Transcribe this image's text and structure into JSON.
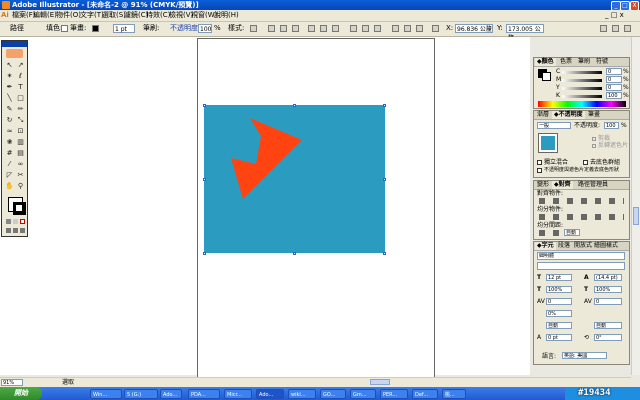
{
  "window": {
    "title": "Adobe Illustrator - [未命名-2 @ 91% (CMYK/預覽)]",
    "controls": [
      "_",
      "□",
      "X"
    ]
  },
  "menu": {
    "items": [
      "檔案(F)",
      "編輯(E)",
      "物件(O)",
      "文字(T)",
      "選取(S)",
      "濾鏡(C)",
      "特效(C)",
      "檢視(V)",
      "視窗(W)",
      "說明(H)"
    ]
  },
  "control_bar": {
    "object_label": "路徑",
    "fill_label": "填色:",
    "stroke_label": "筆畫:",
    "stroke_weight": "1 pt",
    "style_label": "樣式:",
    "opacity_label": "不透明度:",
    "opacity_value": "100",
    "percent": "%",
    "x_value": "96.836 公釐",
    "y_value": "173.005 公釐"
  },
  "colors": {
    "fill_shape": "#ff4411",
    "rect": "#2c9bc0",
    "titlebar": "#0a5ed6"
  },
  "toolbox": {
    "tools": [
      "selection-icon",
      "direct-selection-icon",
      "magic-wand-icon",
      "lasso-icon",
      "pen-icon",
      "type-icon",
      "line-icon",
      "rectangle-icon",
      "paintbrush-icon",
      "pencil-icon",
      "rotate-icon",
      "scale-icon",
      "warp-icon",
      "free-transform-icon",
      "symbol-sprayer-icon",
      "graph-icon",
      "mesh-icon",
      "gradient-icon",
      "eyedropper-icon",
      "blend-icon",
      "slice-icon",
      "scissors-icon",
      "hand-icon",
      "zoom-icon"
    ]
  },
  "color_panel": {
    "tabs": [
      "◆顏色",
      "色票",
      "筆刷",
      "符號"
    ],
    "channels": [
      {
        "name": "C",
        "value": "0"
      },
      {
        "name": "M",
        "value": "0"
      },
      {
        "name": "Y",
        "value": "0"
      },
      {
        "name": "K",
        "value": "100"
      }
    ],
    "percent": "%"
  },
  "transparency_panel": {
    "tabs": [
      "漸層",
      "◆不透明度",
      "筆畫"
    ],
    "mode": "一般",
    "opacity_label": "不透明度:",
    "opacity_value": "100",
    "clip_label": "剪裁",
    "invert_label": "反轉遮色片",
    "isolate_label": "獨立混合",
    "knockout_label": "去底色群組",
    "mask_label": "不透明度與遮色片定義去底色形狀"
  },
  "align_panel": {
    "tabs": [
      "變形",
      "◆對齊",
      "路徑管理員"
    ],
    "align_objects": "對齊物件:",
    "distribute_objects": "均分物件:",
    "distribute_spacing": "均分間距:",
    "spacing_unit": "自動"
  },
  "character_panel": {
    "tabs": [
      "◆字元",
      "段落",
      "開放式",
      "繪圖樣式"
    ],
    "font": "細明體",
    "size": "12 pt",
    "leading": "(14.4 pt)",
    "h_scale": "100%",
    "v_scale": "100%",
    "kerning": "0",
    "tracking": "0",
    "percent0": "0%",
    "auto1": "自動",
    "auto2": "自動",
    "baseline": "0 pt",
    "rotation": "0°",
    "language_label": "語言:",
    "language_value": "英語: 美國"
  },
  "status": {
    "zoom": "91%",
    "mode": "選取"
  },
  "taskbar": {
    "start": "開始",
    "tasks": [
      "Win...",
      "5 (G:)",
      "Ado...",
      "PDA...",
      "Micr...",
      "Ado...",
      "wiki...",
      "GO...",
      "Gm...",
      "PER...",
      "Def...",
      "桃..."
    ],
    "watermark": "#19434"
  }
}
